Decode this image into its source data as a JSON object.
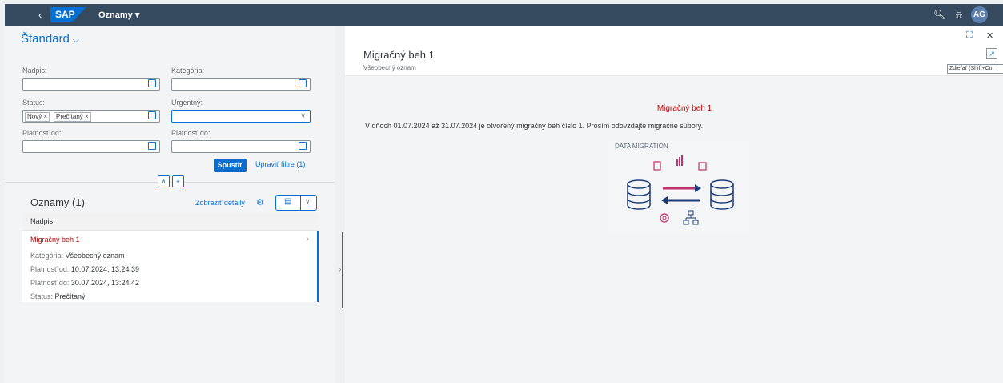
{
  "shell": {
    "back_icon": "chevron-left-icon",
    "logo": "SAP",
    "app_title": "Oznamy ▾",
    "avatar": "AG"
  },
  "filter": {
    "variant": "Štandard",
    "labels": {
      "title": "Nadpis:",
      "category": "Kategória:",
      "status": "Status:",
      "urgent": "Urgentný:",
      "valid_from": "Platnosť od:",
      "valid_to": "Platnosť do:"
    },
    "status_tokens": [
      "Nový ×",
      "Prečítaný ×"
    ],
    "go_label": "Spustiť",
    "adapt_label": "Upraviť filtre (1)"
  },
  "list": {
    "title": "Oznamy (1)",
    "details_label": "Zobraziť detaily",
    "column_header": "Nadpis",
    "items": [
      {
        "title": "Migračný beh 1",
        "attrs": [
          {
            "k": "Kategória:",
            "v": "Všeobecný oznam"
          },
          {
            "k": "Platnosť od:",
            "v": "10.07.2024, 13:24:39"
          },
          {
            "k": "Platnosť do:",
            "v": "30.07.2024, 13:24:42"
          },
          {
            "k": "Status:",
            "v": "Prečítaný"
          }
        ]
      }
    ]
  },
  "detail": {
    "title": "Migračný beh 1",
    "subtitle": "Všeobecný oznam",
    "tooltip": "Zdieľať (Shift+Ctrl",
    "content_title": "Migračný beh 1",
    "content_text": "V dňoch 01.07.2024 až 31.07.2024 je otvorený migračný beh číslo 1. Prosím odovzdajte migračné súbory.",
    "image_title": "DATA MIGRATION"
  },
  "colors": {
    "shell": "#354a5f",
    "accent": "#0a6ed1",
    "negative": "#bb0000",
    "arrow_pink": "#c0306b",
    "arrow_navy": "#1b3a78"
  }
}
